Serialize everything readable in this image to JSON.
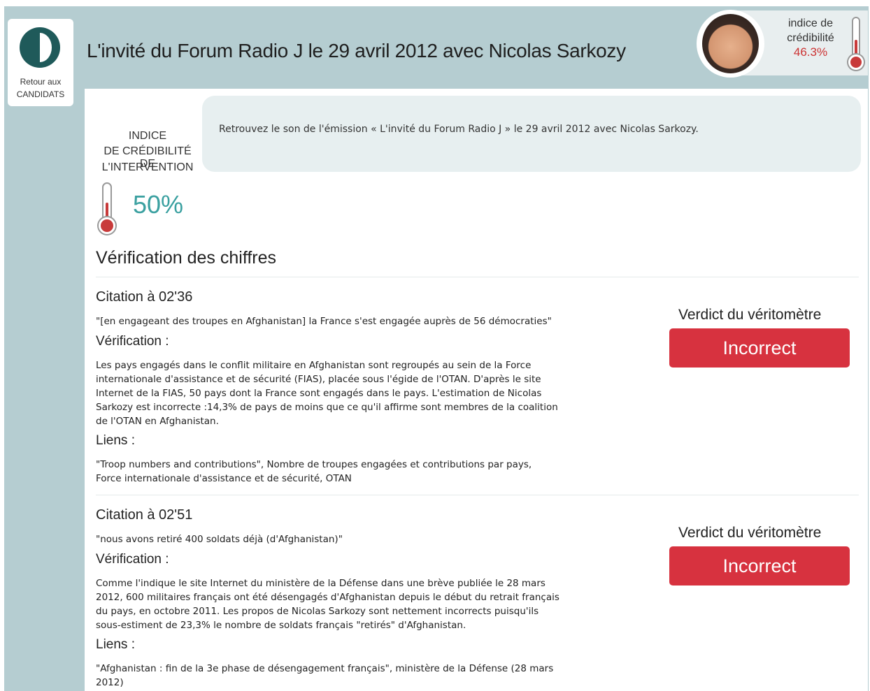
{
  "header": {
    "back_button": {
      "line1": "Retour aux",
      "line2": "CANDIDATS",
      "icon": "back-arrow-icon"
    },
    "title": "L'invité du Forum Radio J le 29 avril 2012 avec Nicolas Sarkozy",
    "credibility": {
      "label_line1": "indice de",
      "label_line2": "crédibilité",
      "value": "46.3%",
      "level": 0.463
    }
  },
  "intervention": {
    "label_line1": "INDICE",
    "label_line2": "DE CRÉDIBILITÉ DE",
    "label_line3": "L'INTERVENTION",
    "value": "50%",
    "level": 0.5
  },
  "audio": {
    "text": "Retrouvez le son de l'émission « L'invité du Forum Radio J » le 29 avril 2012 avec Nicolas Sarkozy."
  },
  "section_title": "Vérification des chiffres",
  "citations": [
    {
      "title": "Citation à 02'36",
      "quote": "\"[en engageant des troupes en Afghanistan] la France s'est engagée auprès de 56 démocraties\"",
      "verification_label": "Vérification :",
      "verification_lines": [
        "Les pays engagés dans le conflit militaire en Afghanistan sont regroupés au sein de la Force",
        "internationale d'assistance et de sécurité (FIAS), placée sous l'égide de l'OTAN. D'après le site",
        "Internet de la FIAS, 50 pays dont la France sont engagés dans le pays. L'estimation de Nicolas",
        "Sarkozy est incorrecte :14,3% de pays de moins que ce qu'il affirme sont membres de la coalition",
        "de l'OTAN en Afghanistan."
      ],
      "links_label": "Liens :",
      "links_lines": [
        "\"Troop numbers and contributions\", Nombre de troupes engagées et contributions par pays,",
        "Force internationale d'assistance et de sécurité, OTAN"
      ],
      "verdict_label": "Verdict du véritomètre",
      "verdict": "Incorrect"
    },
    {
      "title": "Citation à 02'51",
      "quote": "\"nous avons retiré 400 soldats déjà (d'Afghanistan)\"",
      "verification_label": "Vérification :",
      "verification_lines": [
        "Comme l'indique le site Internet du ministère de la Défense dans une brève publiée le 28 mars",
        "2012, 600 militaires français ont été désengagés d'Afghanistan depuis le début du retrait français",
        "du pays, en octobre 2011. Les propos de Nicolas Sarkozy sont nettement incorrects puisqu'ils",
        "sous-estiment de 23,3% le nombre de soldats français \"retirés\" d'Afghanistan."
      ],
      "links_label": "Liens :",
      "links_lines": [
        "\"Afghanistan : fin de la 3e phase de désengagement français\", ministère de la Défense (28 mars",
        "2012)"
      ],
      "verdict_label": "Verdict du véritomètre",
      "verdict": "Incorrect"
    }
  ],
  "colors": {
    "frame": "#b5cdd1",
    "verdict_incorrect": "#d7323f",
    "accent_teal": "#3aa0a0",
    "credibility_red": "#c33"
  }
}
